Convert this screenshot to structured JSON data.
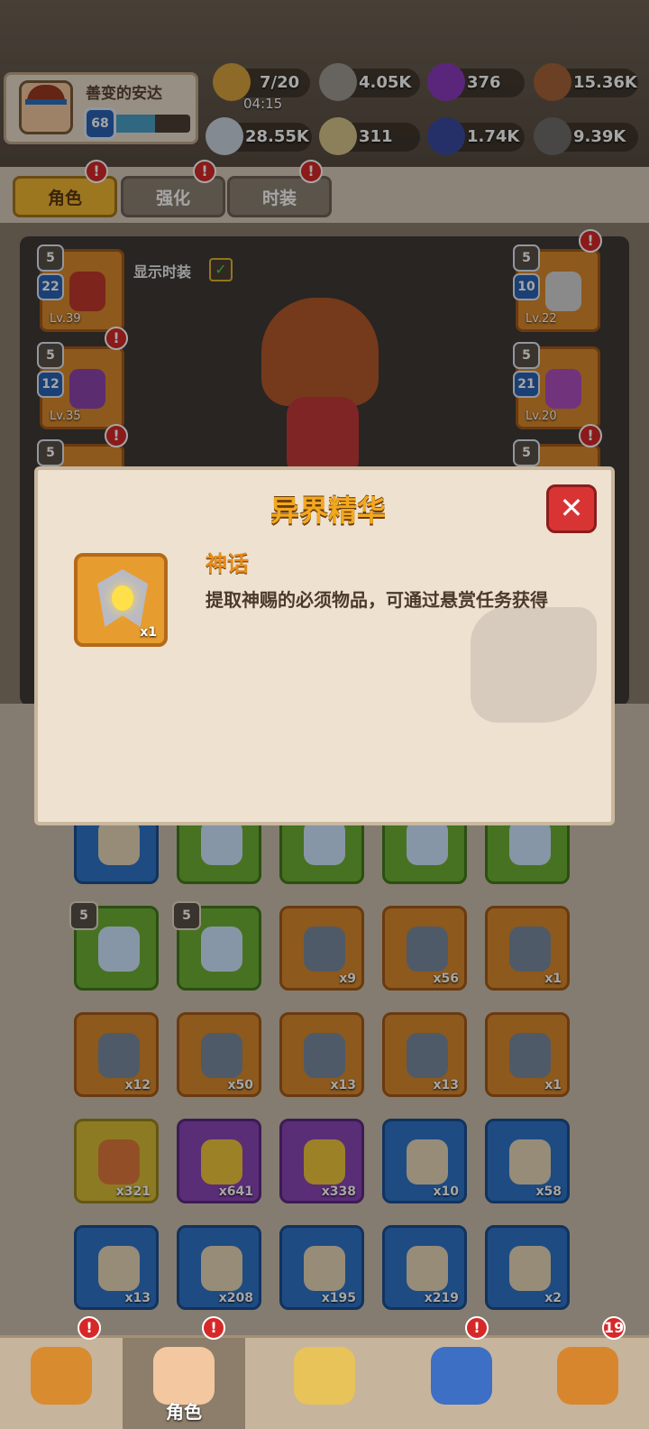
{
  "player": {
    "name": "善变的安达",
    "level": "68",
    "xp_fraction": 0.55
  },
  "resources": {
    "stamina": {
      "value": "7/20",
      "timer": "04:15",
      "icon": "meat-icon"
    },
    "stone": {
      "value": "4.05K",
      "icon": "stone-icon"
    },
    "orb": {
      "value": "376",
      "icon": "purple-orb-icon"
    },
    "wood": {
      "value": "15.36K",
      "icon": "wood-icon"
    },
    "bone": {
      "value": "28.55K",
      "icon": "bone-icon"
    },
    "egg": {
      "value": "311",
      "icon": "egg-icon"
    },
    "crystal": {
      "value": "1.74K",
      "icon": "blue-crystal-icon"
    },
    "ore": {
      "value": "9.39K",
      "icon": "ore-icon"
    }
  },
  "tabs": [
    {
      "label": "角色",
      "active": true,
      "badge": "!"
    },
    {
      "label": "强化",
      "active": false,
      "badge": "!"
    },
    {
      "label": "时装",
      "active": false,
      "badge": "!"
    }
  ],
  "show_fashion_label": "显示时装",
  "equipment": [
    {
      "stars": "5",
      "level": "22",
      "lv": "Lv.39",
      "slot": "left-1"
    },
    {
      "stars": "5",
      "level": "12",
      "lv": "Lv.35",
      "slot": "left-2"
    },
    {
      "stars": "5",
      "level": "10",
      "lv": "Lv.22",
      "slot": "right-1"
    },
    {
      "stars": "5",
      "level": "21",
      "lv": "Lv.20",
      "slot": "right-2"
    },
    {
      "stars": "5",
      "slot": "left-3"
    },
    {
      "stars": "5",
      "slot": "right-3"
    }
  ],
  "dialog": {
    "title": "异界精华",
    "rarity": "神话",
    "description": "提取神赐的必须物品，可通过悬赏任务获得",
    "quantity": "x1",
    "close_icon": "close-icon"
  },
  "inventory": {
    "row1": [
      {
        "color": "blue",
        "qty": ""
      },
      {
        "color": "green",
        "qty": ""
      },
      {
        "color": "green",
        "qty": ""
      },
      {
        "color": "green",
        "qty": ""
      },
      {
        "color": "green",
        "qty": ""
      }
    ],
    "row2": [
      {
        "color": "green",
        "qty": "",
        "stars": "5"
      },
      {
        "color": "green",
        "qty": "",
        "stars": "5"
      },
      {
        "color": "orange",
        "qty": "x9"
      },
      {
        "color": "orange",
        "qty": "x56"
      },
      {
        "color": "orange",
        "qty": "x1"
      }
    ],
    "row3": [
      {
        "color": "orange",
        "qty": "x12"
      },
      {
        "color": "orange",
        "qty": "x50"
      },
      {
        "color": "orange",
        "qty": "x13"
      },
      {
        "color": "orange",
        "qty": "x13"
      },
      {
        "color": "orange",
        "qty": "x1"
      }
    ],
    "row4": [
      {
        "color": "yellow",
        "qty": "x321"
      },
      {
        "color": "purple",
        "qty": "x641"
      },
      {
        "color": "purple",
        "qty": "x338"
      },
      {
        "color": "blue",
        "qty": "x10"
      },
      {
        "color": "blue",
        "qty": "x58"
      }
    ],
    "row5": [
      {
        "color": "blue",
        "qty": "x13"
      },
      {
        "color": "blue",
        "qty": "x208"
      },
      {
        "color": "blue",
        "qty": "x195"
      },
      {
        "color": "blue",
        "qty": "x219"
      },
      {
        "color": "blue",
        "qty": "x2"
      }
    ]
  },
  "bottom_nav": [
    {
      "icon": "tiger-helmet-icon",
      "label": "",
      "badge": "!"
    },
    {
      "icon": "hero-face-icon",
      "label": "角色",
      "badge": "!",
      "active": true
    },
    {
      "icon": "treasure-map-icon",
      "label": "",
      "badge": ""
    },
    {
      "icon": "wolf-pet-icon",
      "label": "",
      "badge": "!"
    },
    {
      "icon": "loot-bag-icon",
      "label": "",
      "badge": "19"
    }
  ]
}
